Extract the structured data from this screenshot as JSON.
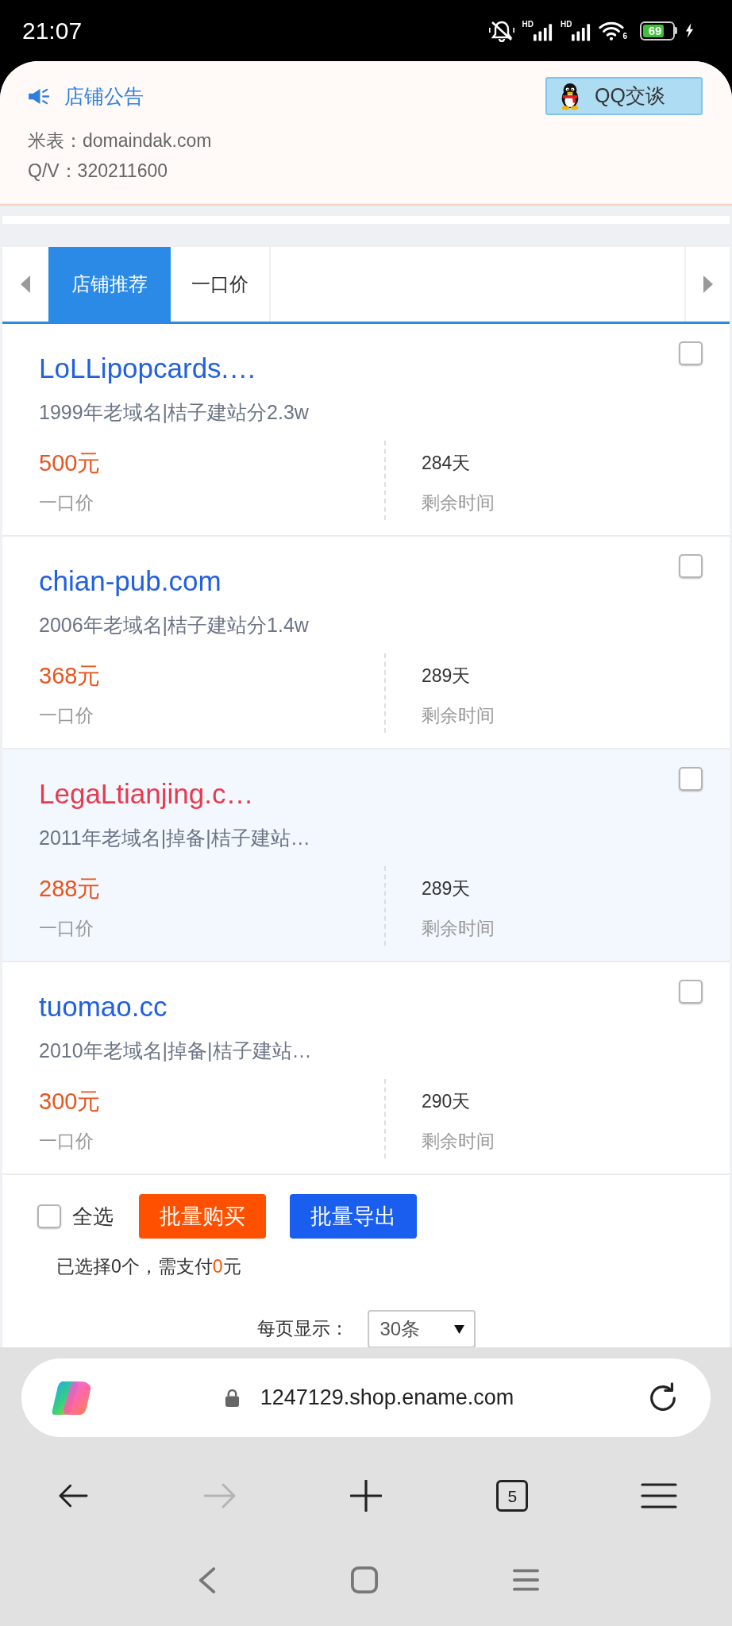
{
  "status_bar": {
    "time": "21:07",
    "signals": [
      {
        "label": "HD"
      },
      {
        "label": "HD"
      }
    ],
    "wifi_label": "6",
    "battery": "69"
  },
  "notice": {
    "title": "店铺公告",
    "chat_button": "QQ交谈",
    "lines": [
      "米表：domaindak.com",
      "Q/V：320211600"
    ]
  },
  "tabs": [
    {
      "label": "店铺推荐",
      "selected": true
    },
    {
      "label": "一口价",
      "selected": false
    }
  ],
  "listings": [
    {
      "domain": "LoLLipopcards.…",
      "description": "1999年老域名|桔子建站分2.3w",
      "price": "500元",
      "price_label": "一口价",
      "remaining": "284天",
      "remaining_label": "剩余时间",
      "checked": false,
      "highlighted": false
    },
    {
      "domain": "chian-pub.com",
      "description": "2006年老域名|桔子建站分1.4w",
      "price": "368元",
      "price_label": "一口价",
      "remaining": "289天",
      "remaining_label": "剩余时间",
      "checked": false,
      "highlighted": false
    },
    {
      "domain": "LegaLtianjing.c…",
      "description": "2011年老域名|掉备|桔子建站…",
      "price": "288元",
      "price_label": "一口价",
      "remaining": "289天",
      "remaining_label": "剩余时间",
      "checked": false,
      "highlighted": true
    },
    {
      "domain": "tuomao.cc",
      "description": "2010年老域名|掉备|桔子建站…",
      "price": "300元",
      "price_label": "一口价",
      "remaining": "290天",
      "remaining_label": "剩余时间",
      "checked": false,
      "highlighted": false
    }
  ],
  "bulk_actions": {
    "select_all": {
      "label": "全选",
      "checked": false
    },
    "buttons": [
      {
        "label": "批量购买",
        "kind": "buy"
      },
      {
        "label": "批量导出",
        "kind": "export"
      }
    ],
    "summary": {
      "before": "已选择0个，需支付",
      "amount": "0",
      "after": "元"
    },
    "page_size": {
      "label": "每页显示：",
      "value": "30条"
    }
  },
  "browser": {
    "url": "1247129.shop.ename.com",
    "tab_count": "5",
    "forward_disabled": true
  }
}
